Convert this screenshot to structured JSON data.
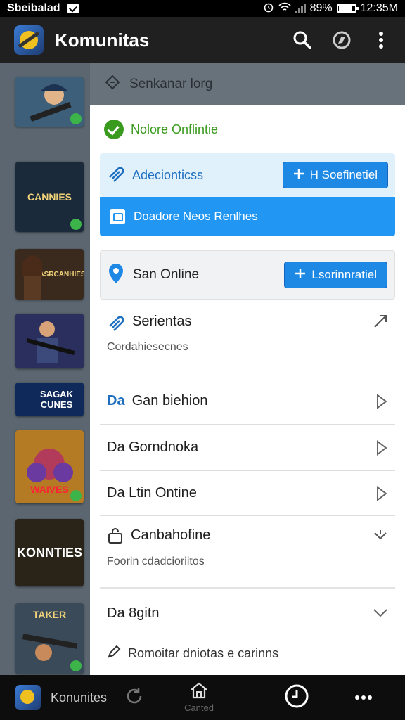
{
  "status_bar": {
    "carrier": "Sbeibalad",
    "battery": "89%",
    "time": "12:35M"
  },
  "appbar": {
    "title": "Komunitas"
  },
  "games": [
    {
      "title": "",
      "bg": "#2f6a4a"
    },
    {
      "title": "CANNIES",
      "bg": "#1b2a3a"
    },
    {
      "title": "ASRCANHIES",
      "bg": "#3a2a1e"
    },
    {
      "title": "",
      "bg": "#24305a"
    },
    {
      "title": "SAGAK CUNES",
      "bg": "#0f2a5a"
    },
    {
      "title": "WAIVES",
      "bg": "#8a5a1a"
    },
    {
      "title": "KONNTIES",
      "bg": "#2a2418"
    },
    {
      "title": "TAKER",
      "bg": "#1e2a38"
    }
  ],
  "panel": {
    "header": "Senkanar lorg",
    "status": "Nolore Onflintie",
    "cards": {
      "light": {
        "label": "Adecionticss",
        "button": "H Soefinetiel"
      },
      "solid": {
        "label": "Doadore Neos Renlhes"
      },
      "grey": {
        "label": "San Online",
        "button": "Lsorinnratiel"
      }
    },
    "rows": [
      {
        "title": "Serientas",
        "sub": "Cordahiesecnes"
      },
      {
        "prefix": "Da",
        "title": "Gan biehion"
      },
      {
        "title": "Da Gorndnoka"
      },
      {
        "title": "Da Ltin Ontine"
      },
      {
        "title": "Canbahofine",
        "sub": "Foorin cdadcioriitos"
      },
      {
        "title": "Da 8gitn"
      },
      {
        "title": "Romoitar dniotas e carinns"
      }
    ]
  },
  "bottombar": {
    "label": "Konunites",
    "center_label": "Canted"
  },
  "colors": {
    "accent": "#2196f3",
    "success": "#3a9a1e",
    "appbar": "#202020"
  }
}
